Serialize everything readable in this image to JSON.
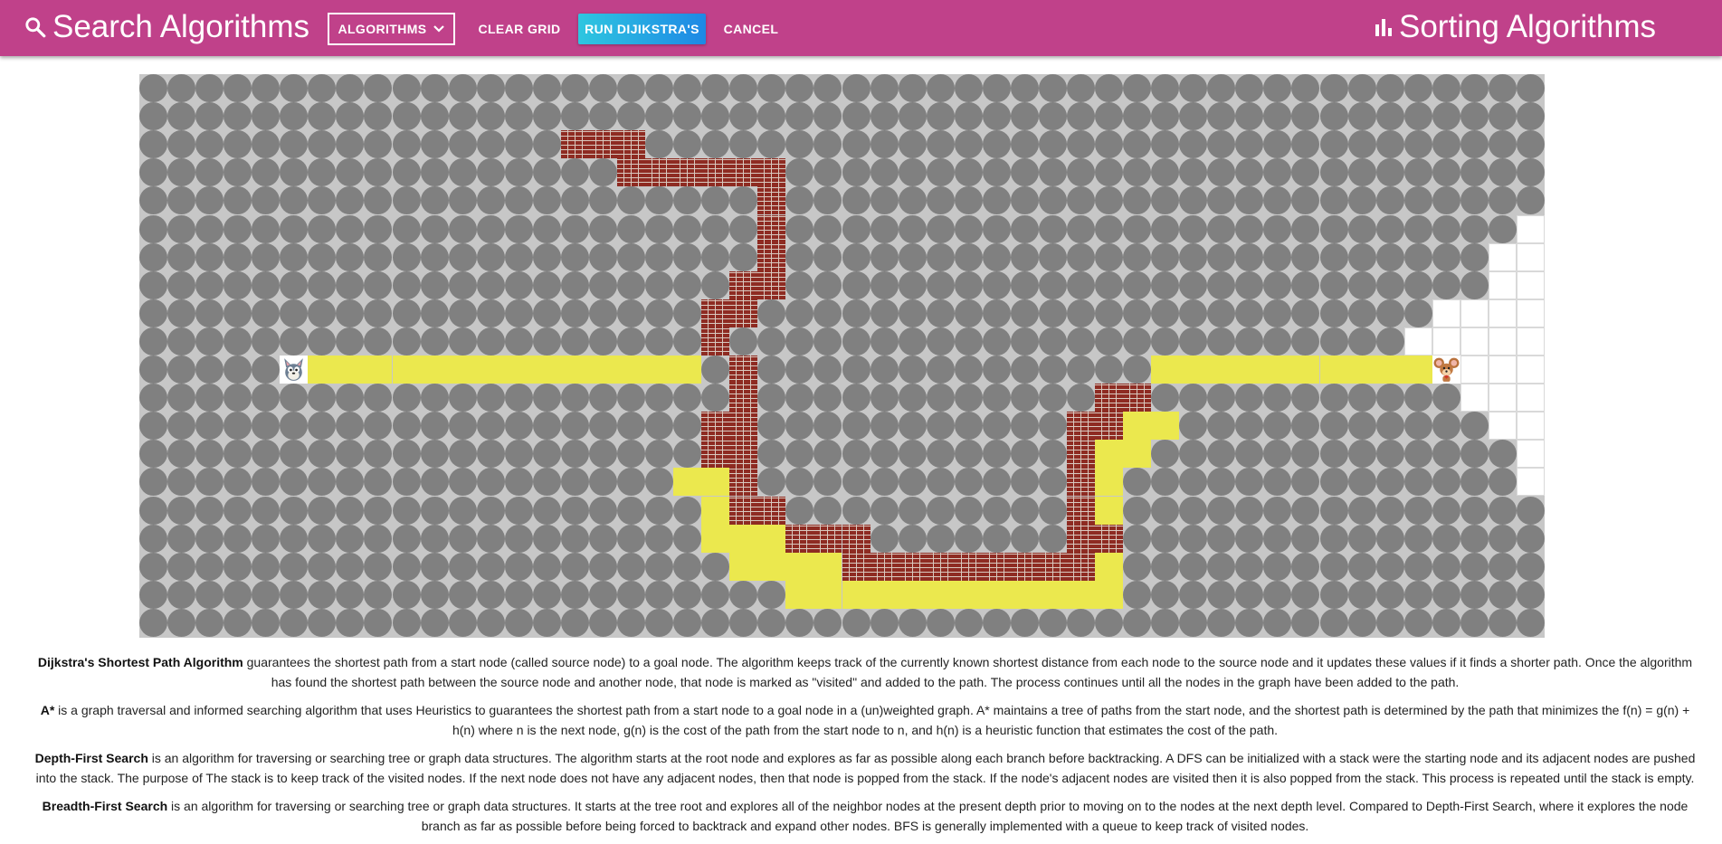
{
  "header": {
    "search_title": "Search Algorithms",
    "algorithms_label": "ALGORITHMS",
    "clear_label": "CLEAR GRID",
    "run_label": "RUN DIJIKSTRA'S",
    "cancel_label": "CANCEL",
    "sorting_title": "Sorting Algorithms"
  },
  "colors": {
    "header_bg": "#c0418a",
    "grid_bg": "#c7c7c7",
    "unvisited": "#808080",
    "path": "#ebe84e",
    "wall": "#8e2b22",
    "run_button_from": "#2ec6e0",
    "run_button_to": "#1e88e5"
  },
  "icons": {
    "search": "search-icon",
    "dropdown": "chevron-down-icon",
    "sorting": "bar-chart-icon",
    "start_node": "tom-cat-icon",
    "end_node": "jerry-mouse-icon"
  },
  "grid": {
    "rows": 20,
    "cols": 50,
    "legend": "u = unvisited node, . = empty node, p = shortest path, w = wall, S = start, E = end",
    "cells": [
      "uuuuuuuuuuuuuuuuuuuuuuuuuuuuuuuuuuuuuuuuuuuuuuuuuu",
      "uuuuuuuuuuuuuuuuuuuuuuuuuuuuuuuuuuuuuuuuuuuuuuuuuu",
      "uuuuuuuuuuuuuuuwwwuuuuuuuuuuuuuuuuuuuuuuuuuuuuuuuu",
      "uuuuuuuuuuuuuuuuuwwwwwwuuuuuuuuuuuuuuuuuuuuuuuuuuu",
      "uuuuuuuuuuuuuuuuuuuuuuwuuuuuuuuuuuuuuuuuuuuuuuuuuu",
      "uuuuuuuuuuuuuuuuuuuuuuwuuuuuuuuuuuuuuuuuuuuuuuuuu.",
      "uuuuuuuuuuuuuuuuuuuuuuwuuuuuuuuuuuuuuuuuuuuuuuuu..",
      "uuuuuuuuuuuuuuuuuuuuuwwuuuuuuuuuuuuuuuuuuuuuuuuu..",
      "uuuuuuuuuuuuuuuuuuuuwwuuuuuuuuuuuuuuuuuuuuuuuu....",
      "uuuuuuuuuuuuuuuuuuuuwuuuuuuuuuuuuuuuuuuuuuuuu.....",
      "uuuuuSppppppppppppppuwuuuuuuuuuuuuuuppppppppppE...",
      "uuuuuuuuuuuuuuuuuuuuuwuuuuuuuuuuuuwwuuuuuuuuuuu...",
      "uuuuuuuuuuuuuuuuuuuuwwuuuuuuuuuuuwwppuuuuuuuuuuu..",
      "uuuuuuuuuuuuuuuuuuuuwwuuuuuuuuuuuwppuuuuuuuuuuuuu.",
      "uuuuuuuuuuuuuuuuuuuppwuuuuuuuuuuuwpuuuuuuuuuuuuuu.",
      "uuuuuuuuuuuuuuuuuuuupwwuuuuuuuuuuwpuuuuuuuuuuuuuuu",
      "uuuuuuuuuuuuuuuuuuuupppwwwuuuuuuuwwuuuuuuuuuuuuuuu",
      "uuuuuuuuuuuuuuuuuuuuuppppwwwwwwwwwpuuuuuuuuuuuuuuu",
      "uuuuuuuuuuuuuuuuuuuuuuuppppppppppppuuuuuuuuuuuuuuu",
      "uuuuuuuuuuuuuuuuuuuuuuuuuuuuuuuuuuuuuuuuuuuuuuuuuu"
    ]
  },
  "descriptions": [
    {
      "title": "Dijkstra's Shortest Path Algorithm",
      "text": " guarantees the shortest path from a start node (called source node) to a goal node. The algorithm keeps track of the currently known shortest distance from each node to the source node and it updates these values if it finds a shorter path. Once the algorithm has found the shortest path between the source node and another node, that node is marked as \"visited\" and added to the path. The process continues until all the nodes in the graph have been added to the path."
    },
    {
      "title": "A*",
      "text": " is a graph traversal and informed searching algorithm that uses Heuristics to guarantees the shortest path from a start node to a goal node in a (un)weighted graph. A* maintains a tree of paths from the start node, and the shortest path is determined by the path that minimizes the f(n) = g(n) + h(n) where n is the next node, g(n) is the cost of the path from the start node to n, and h(n) is a heuristic function that estimates the cost of the path."
    },
    {
      "title": "Depth-First Search",
      "text": " is an algorithm for traversing or searching tree or graph data structures. The algorithm starts at the root node and explores as far as possible along each branch before backtracking. A DFS can be initialized with a stack were the starting node and its adjacent nodes are pushed into the stack. The purpose of The stack is to keep track of the visited nodes. If the next node does not have any adjacent nodes, then that node is popped from the stack. If the node's adjacent nodes are visited then it is also popped from the stack. This process is repeated until the stack is empty."
    },
    {
      "title": "Breadth-First Search",
      "text": " is an algorithm for traversing or searching tree or graph data structures. It starts at the tree root and explores all of the neighbor nodes at the present depth prior to moving on to the nodes at the next depth level. Compared to Depth-First Search, where it explores the node branch as far as possible before being forced to backtrack and expand other nodes. BFS is generally implemented with a queue to keep track of visited nodes."
    }
  ]
}
